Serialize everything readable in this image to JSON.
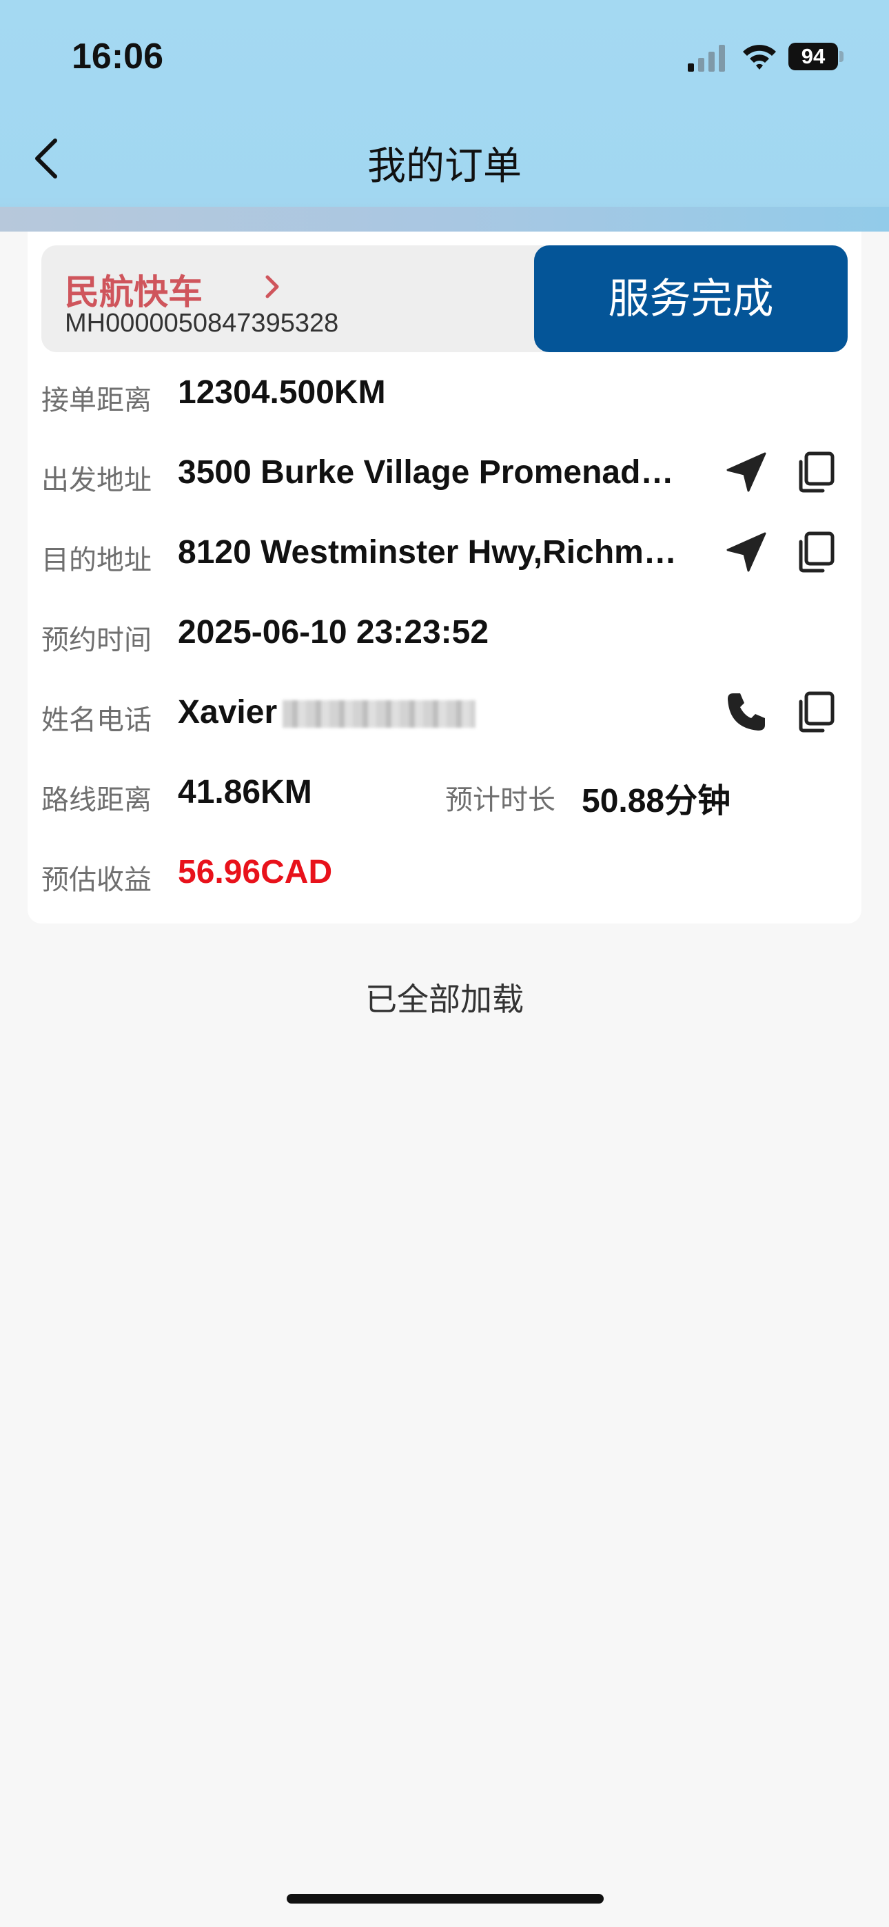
{
  "status_bar": {
    "time": "16:06",
    "battery": "94"
  },
  "nav": {
    "title": "我的订单"
  },
  "order": {
    "service_name": "民航快车",
    "order_number": "MH0000050847395328",
    "status_button": "服务完成",
    "fields": {
      "pickup_distance": {
        "label": "接单距离",
        "value": "12304.500KM"
      },
      "origin": {
        "label": "出发地址",
        "value": "3500 Burke Village Promenad…"
      },
      "destination": {
        "label": "目的地址",
        "value": "8120 Westminster Hwy,Richm…"
      },
      "appointment_time": {
        "label": "预约时间",
        "value": "2025-06-10 23:23:52"
      },
      "contact": {
        "label": "姓名电话",
        "name": "Xavier"
      },
      "route_distance": {
        "label": "路线距离",
        "value": "41.86KM"
      },
      "estimated_duration": {
        "label": "预计时长",
        "value": "50.88分钟"
      },
      "estimated_earnings": {
        "label": "预估收益",
        "value": "56.96CAD"
      }
    },
    "colors": {
      "service_name": "#cf555c",
      "status_button": "#045598",
      "earnings": "#e8121b"
    }
  },
  "list_footer": "已全部加载"
}
